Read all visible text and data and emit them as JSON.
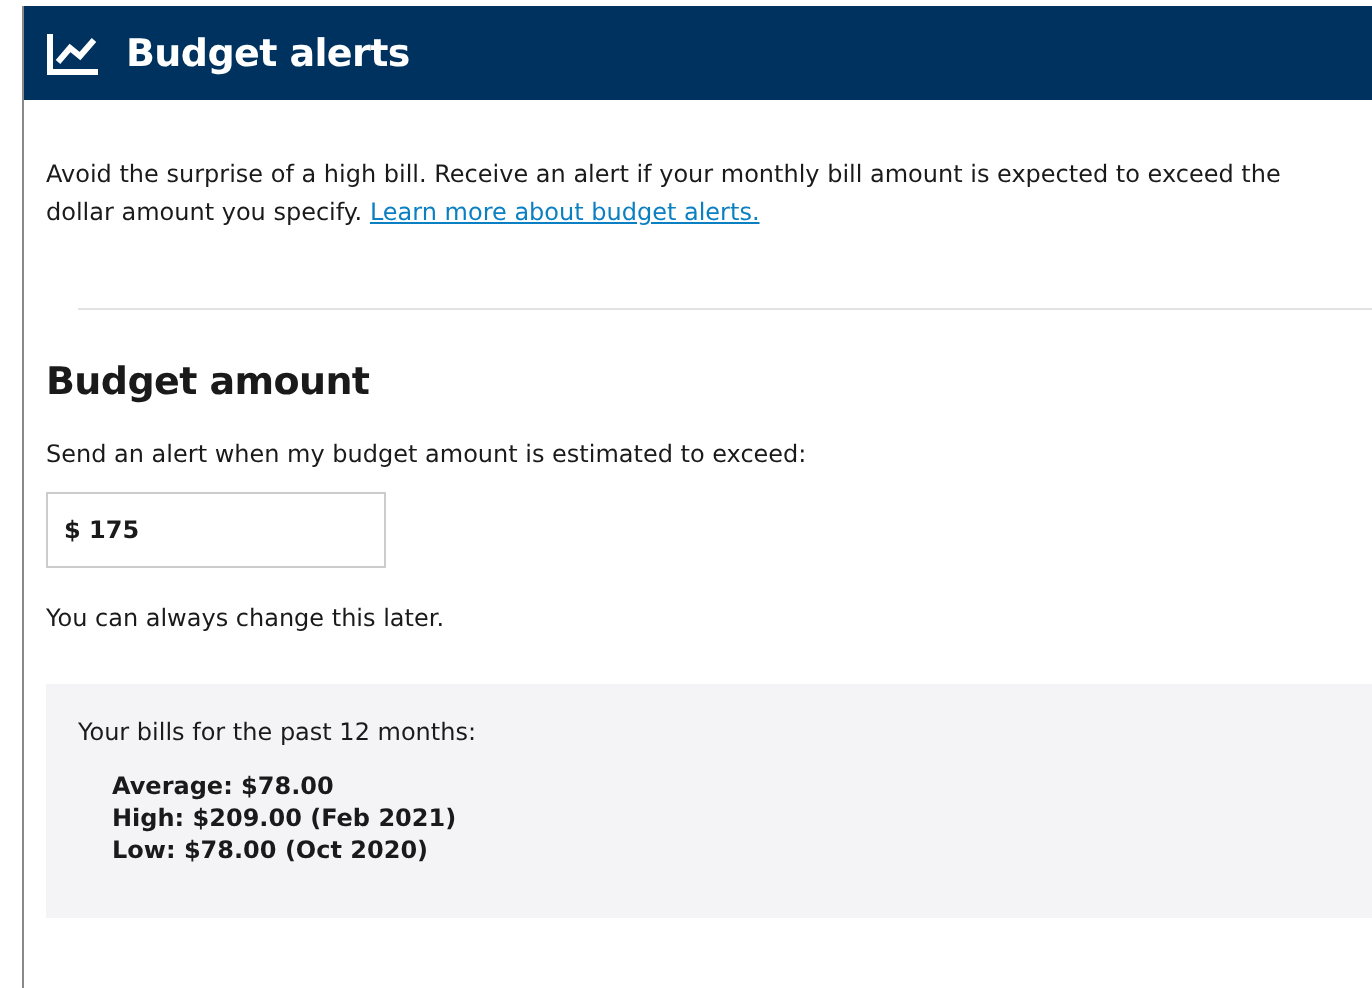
{
  "header": {
    "title": "Budget alerts"
  },
  "intro": {
    "text": "Avoid the surprise of a high bill. Receive an alert if your monthly bill amount is expected to exceed the dollar amount you specify.",
    "link": "Learn more about budget alerts."
  },
  "budget": {
    "heading": "Budget amount",
    "prompt": "Send an alert when my budget amount is estimated to exceed:",
    "value": "$ 175",
    "note": "You can always change this later."
  },
  "bills": {
    "title": "Your bills for the past 12 months:",
    "lines": [
      "Average: $78.00",
      "High: $209.00 (Feb 2021)",
      "Low: $78.00 (Oct 2020)"
    ]
  }
}
